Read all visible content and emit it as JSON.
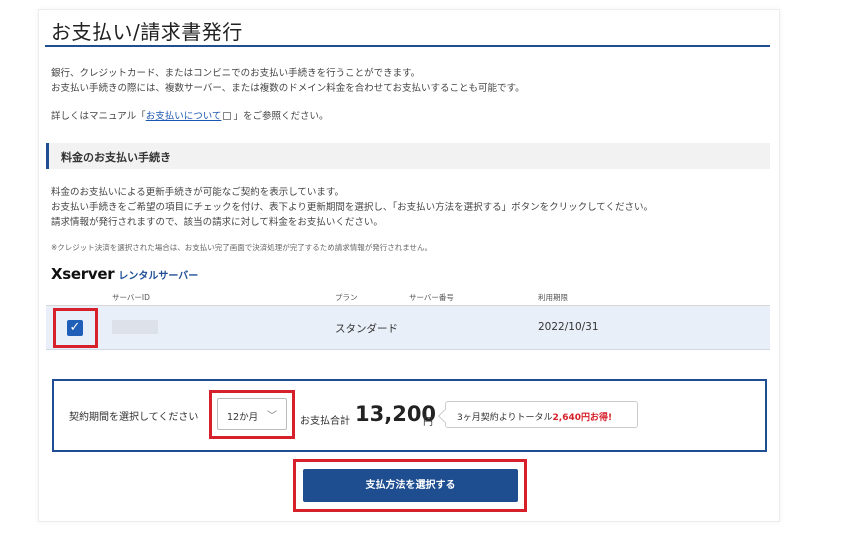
{
  "page": {
    "title": "お支払い/請求書発行"
  },
  "intro": {
    "line1": "銀行、クレジットカード、またはコンビニでのお支払い手続きを行うことができます。",
    "line2": "お支払い手続きの際には、複数サーバー、または複数のドメイン料金を合わせてお支払いすることも可能です。",
    "line3_prefix": "詳しくはマニュアル「",
    "manual_link": "お支払いについて",
    "line3_suffix": "」をご参照ください。"
  },
  "section": {
    "heading": "料金のお支払い手続き",
    "desc1": "料金のお支払いによる更新手続きが可能なご契約を表示しています。",
    "desc2": "お支払い手続きをご希望の項目にチェックを付け、表下より更新期間を選択し、「お支払い方法を選択する」ボタンをクリックしてください。",
    "desc3": "請求情報が発行されますので、該当の請求に対して料金をお支払いください。",
    "note": "※クレジット決済を選択された場合は、お支払い完了画面で決済処理が完了するため請求情報が発行されません。"
  },
  "brand": {
    "logo": "Xserver",
    "sub": "レンタルサーバー"
  },
  "table": {
    "headers": {
      "server_id": "サーバーID",
      "plan": "プラン",
      "server_no": "サーバー番号",
      "expiry": "利用期限"
    },
    "rows": [
      {
        "checked": true,
        "server_id": "",
        "plan": "スタンダード",
        "server_no": "",
        "expiry": "2022/10/31"
      }
    ]
  },
  "period": {
    "label": "契約期間を選択してください",
    "selected": "12か月",
    "total_label": "お支払合計",
    "total_value": "13,200",
    "total_unit": "円",
    "promo_prefix": "3ヶ月契約よりトータル",
    "promo_highlight": "2,640円お得!"
  },
  "actions": {
    "pay_button": "支払方法を選択する"
  },
  "colors": {
    "accent": "#1f4e95",
    "highlight": "#d6202b",
    "row_bg": "#e9eff8"
  }
}
